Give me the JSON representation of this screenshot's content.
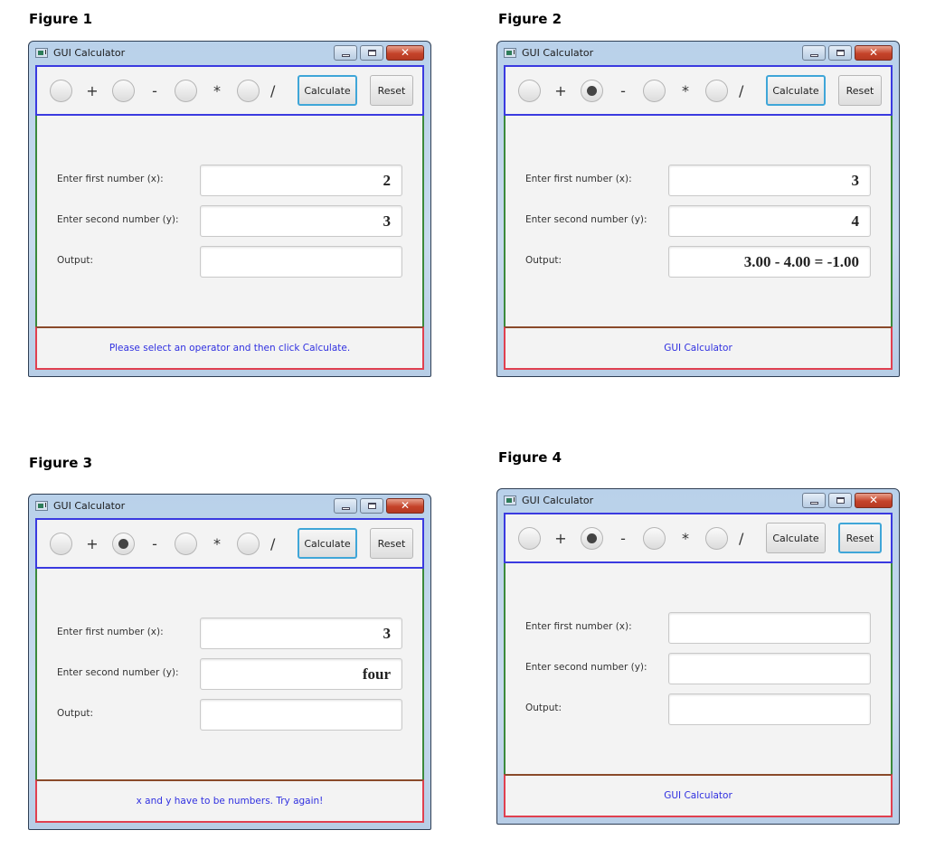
{
  "figures": [
    {
      "label": "Figure 1",
      "window_title": "GUI Calculator",
      "operators": [
        {
          "symbol": "+",
          "checked": false
        },
        {
          "symbol": "-",
          "checked": false
        },
        {
          "symbol": "*",
          "checked": false
        },
        {
          "symbol": "/",
          "checked": false
        }
      ],
      "buttons": {
        "calculate": "Calculate",
        "reset": "Reset",
        "focused": "calculate"
      },
      "labels": {
        "x": "Enter first number (x):",
        "y": "Enter second number (y):",
        "output": "Output:"
      },
      "values": {
        "x": "2",
        "y": "3",
        "output": ""
      },
      "status": "Please select an operator and then click Calculate."
    },
    {
      "label": "Figure 2",
      "window_title": "GUI Calculator",
      "operators": [
        {
          "symbol": "+",
          "checked": false
        },
        {
          "symbol": "-",
          "checked": true
        },
        {
          "symbol": "*",
          "checked": false
        },
        {
          "symbol": "/",
          "checked": false
        }
      ],
      "buttons": {
        "calculate": "Calculate",
        "reset": "Reset",
        "focused": "calculate"
      },
      "labels": {
        "x": "Enter first number (x):",
        "y": "Enter second number (y):",
        "output": "Output:"
      },
      "values": {
        "x": "3",
        "y": "4",
        "output": "3.00 - 4.00 = -1.00"
      },
      "status": "GUI Calculator"
    },
    {
      "label": "Figure 3",
      "window_title": "GUI Calculator",
      "operators": [
        {
          "symbol": "+",
          "checked": false
        },
        {
          "symbol": "-",
          "checked": true
        },
        {
          "symbol": "*",
          "checked": false
        },
        {
          "symbol": "/",
          "checked": false
        }
      ],
      "buttons": {
        "calculate": "Calculate",
        "reset": "Reset",
        "focused": "calculate"
      },
      "labels": {
        "x": "Enter first number (x):",
        "y": "Enter second number (y):",
        "output": "Output:"
      },
      "values": {
        "x": "3",
        "y": "four",
        "output": ""
      },
      "status": "x and y have to be numbers. Try again!"
    },
    {
      "label": "Figure 4",
      "window_title": "GUI Calculator",
      "operators": [
        {
          "symbol": "+",
          "checked": false
        },
        {
          "symbol": "-",
          "checked": true
        },
        {
          "symbol": "*",
          "checked": false
        },
        {
          "symbol": "/",
          "checked": false
        }
      ],
      "buttons": {
        "calculate": "Calculate",
        "reset": "Reset",
        "focused": "reset"
      },
      "labels": {
        "x": "Enter first number (x):",
        "y": "Enter second number (y):",
        "output": "Output:"
      },
      "values": {
        "x": "",
        "y": "",
        "output": ""
      },
      "status": "GUI Calculator"
    }
  ],
  "window_controls": {
    "minimize": "minimize-icon",
    "maximize": "maximize-icon",
    "close": "close-icon",
    "close_glyph": "✕"
  },
  "colors": {
    "toolbar_border": "#3a3ae0",
    "center_border": "#3b8a3b",
    "status_border": "#e04050",
    "status_text": "#3030e0",
    "focus_ring": "#3fa6d8"
  }
}
